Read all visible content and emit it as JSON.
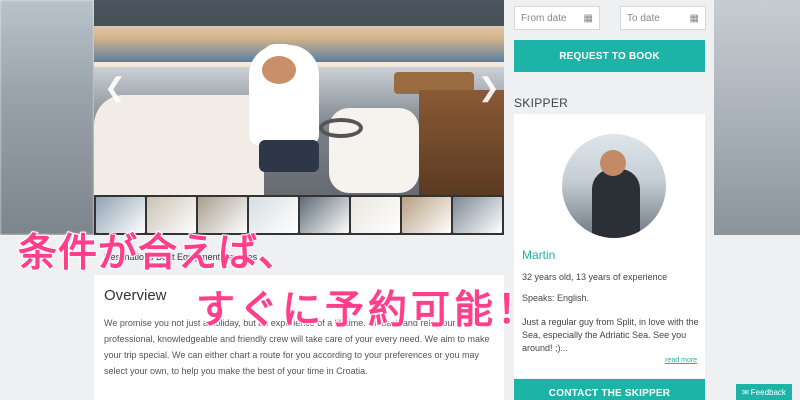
{
  "gallery": {
    "prev_icon": "chevron-left-icon",
    "next_icon": "chevron-right-icon",
    "thumbnail_colors": [
      "#8fa3b3",
      "#c9c2b4",
      "#a89f8f",
      "#d8dde2",
      "#5e6a75",
      "#eae6df",
      "#b89f83",
      "#7b8894"
    ]
  },
  "booking": {
    "from_placeholder": "From date",
    "to_placeholder": "To date",
    "calendar_icon": "calendar-icon",
    "request_label": "REQUEST TO BOOK"
  },
  "skipper": {
    "section_title": "SKIPPER",
    "name": "Martin",
    "age_experience": "32 years old, 13 years of experience",
    "speaks": "Speaks: English.",
    "bio": "Just a regular guy from Split, in love with the Sea, especially the Adriatic Sea. See you around! ;)...",
    "read_more": "read more",
    "contact_label": "CONTACT THE SKIPPER"
  },
  "content": {
    "tabs_text": "Destinations Boat Equipment Services",
    "overview_title": "Overview",
    "overview_text": "We promise you not just a holiday, but an experience of a lifetime. Sit back and relax our professional, knowledgeable and friendly crew will take care of your every need. We aim to make your trip special. We can either chart a route for you according to your preferences or you may select your own, to help you make the best of your time in Croatia."
  },
  "overlay": {
    "line1": "条件が合えば、",
    "line2": "すぐに予約可能！"
  },
  "feedback": {
    "label": "Feedback",
    "icon": "chat-icon"
  },
  "colors": {
    "accent": "#1db4a8",
    "overlay_pink": "#ff3f8b"
  }
}
